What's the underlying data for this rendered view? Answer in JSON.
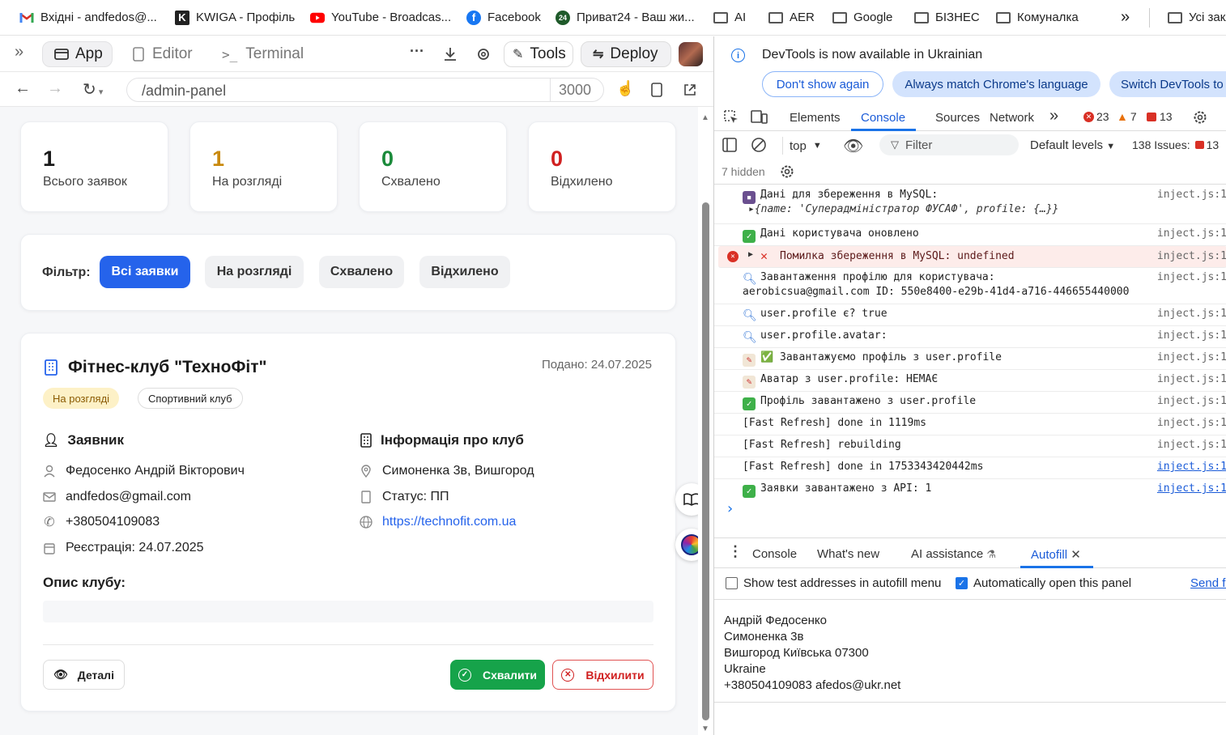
{
  "bookmarks": [
    {
      "icon": "gmail-icon",
      "label": "Вхідні - andfedos@..."
    },
    {
      "icon": "kwiga-icon",
      "label": "KWIGA - Профіль"
    },
    {
      "icon": "youtube-icon",
      "label": "YouTube - Broadcas..."
    },
    {
      "icon": "facebook-icon",
      "label": "Facebook"
    },
    {
      "icon": "privat24-icon",
      "label": "Приват24 - Ваш жи..."
    },
    {
      "icon": "folder-icon",
      "label": "AI"
    },
    {
      "icon": "folder-icon",
      "label": "AER"
    },
    {
      "icon": "folder-icon",
      "label": "Google"
    },
    {
      "icon": "folder-icon",
      "label": "БІЗНЕС"
    },
    {
      "icon": "folder-icon",
      "label": "Комуналка"
    }
  ],
  "bookmarks_more": "»",
  "bookmarks_all": "Усі закладки",
  "app_toolbar": {
    "expand": "»",
    "app": "App",
    "editor": "Editor",
    "terminal": "Terminal",
    "more": "···",
    "tools": "Tools",
    "deploy": "Deploy"
  },
  "url": {
    "path": "/admin-panel",
    "port": "3000"
  },
  "stats": [
    {
      "value": "1",
      "label": "Всього заявок",
      "color": "#1a1a1a"
    },
    {
      "value": "1",
      "label": "На розгляді",
      "color": "#c98a10"
    },
    {
      "value": "0",
      "label": "Схвалено",
      "color": "#1a8a3a"
    },
    {
      "value": "0",
      "label": "Відхилено",
      "color": "#d02020"
    }
  ],
  "filter": {
    "label": "Фільтр:",
    "buttons": [
      "Всі заявки",
      "На розгляді",
      "Схвалено",
      "Відхилено"
    ],
    "active": 0
  },
  "application": {
    "title": "Фітнес-клуб \"ТехноФіт\"",
    "submitted": "Подано: 24.07.2025",
    "badge_status": "На розгляді",
    "badge_type": "Спортивний клуб",
    "applicant_heading": "Заявник",
    "applicant": {
      "name": "Федосенко Андрій Вікторович",
      "email": "andfedos@gmail.com",
      "phone": "+380504109083",
      "registered": "Реєстрація: 24.07.2025"
    },
    "club_heading": "Інформація про клуб",
    "club": {
      "address": "Симоненка 3в, Вишгород",
      "status": "Статус: ПП",
      "website": "https://technofit.com.ua"
    },
    "description_heading": "Опис клубу:",
    "details_btn": "Деталі",
    "approve_btn": "Схвалити",
    "reject_btn": "Відхилити"
  },
  "devtools": {
    "banner": "DevTools is now available in Ukrainian",
    "banner_buttons": [
      "Don't show again",
      "Always match Chrome's language",
      "Switch DevTools to"
    ],
    "tabs": [
      "Elements",
      "Console",
      "Sources",
      "Network"
    ],
    "active_tab": "Console",
    "errors": "23",
    "warnings": "7",
    "messages": "13",
    "context": "top",
    "filter_placeholder": "Filter",
    "levels": "Default levels",
    "issues_label": "138 Issues:",
    "issues_count": "13",
    "hidden": "7 hidden",
    "logs": [
      {
        "icon": "floppy",
        "text": "Дані для збереження в MySQL:",
        "link": "inject.js:1"
      },
      {
        "icon": "none",
        "text": "▸{name: 'Суперадміністратор ФУСАФ', profile: {…}}",
        "link": ""
      },
      {
        "icon": "check",
        "text": "Дані користувача оновлено",
        "link": "inject.js:1"
      },
      {
        "icon": "error",
        "text": "Помилка збереження в MySQL: undefined",
        "link": "inject.js:1"
      },
      {
        "icon": "mag",
        "text": "Завантаження профілю для користувача:",
        "link": "inject.js:1"
      },
      {
        "icon": "none",
        "text": "aerobicsua@gmail.com ID: 550e8400-e29b-41d4-a716-446655440000",
        "link": ""
      },
      {
        "icon": "mag",
        "text": "user.profile є? true",
        "link": "inject.js:1"
      },
      {
        "icon": "mag",
        "text": "user.profile.avatar:",
        "link": "inject.js:1"
      },
      {
        "icon": "memo",
        "text": "✅ Завантажуємо профіль з user.profile",
        "link": "inject.js:1"
      },
      {
        "icon": "memo",
        "text": "Аватар з user.profile: НЕМАЄ",
        "link": "inject.js:1"
      },
      {
        "icon": "check",
        "text": "Профіль завантажено з user.profile",
        "link": "inject.js:1"
      },
      {
        "icon": "none",
        "text": "[Fast Refresh] done in 1119ms",
        "link": "inject.js:1"
      },
      {
        "icon": "none",
        "text": "[Fast Refresh] rebuilding",
        "link": "inject.js:1"
      },
      {
        "icon": "none",
        "text": "[Fast Refresh] done in 1753343420442ms",
        "link": "inject.js:1"
      },
      {
        "icon": "check",
        "text": "Заявки завантажено з API: 1",
        "link": "inject.js:1"
      }
    ],
    "prompt": "›",
    "drawer_tabs": [
      "Console",
      "What's new",
      "AI assistance",
      "Autofill"
    ],
    "drawer_active": "Autofill",
    "autofill": {
      "show_test": "Show test addresses in autofill menu",
      "auto_open": "Automatically open this panel",
      "send": "Send feedback",
      "address": [
        "Андрій Федосенко",
        "Симоненка 3в",
        "Вишгород Київська 07300",
        "Ukraine",
        "+380504109083 afedos@ukr.net"
      ]
    }
  }
}
